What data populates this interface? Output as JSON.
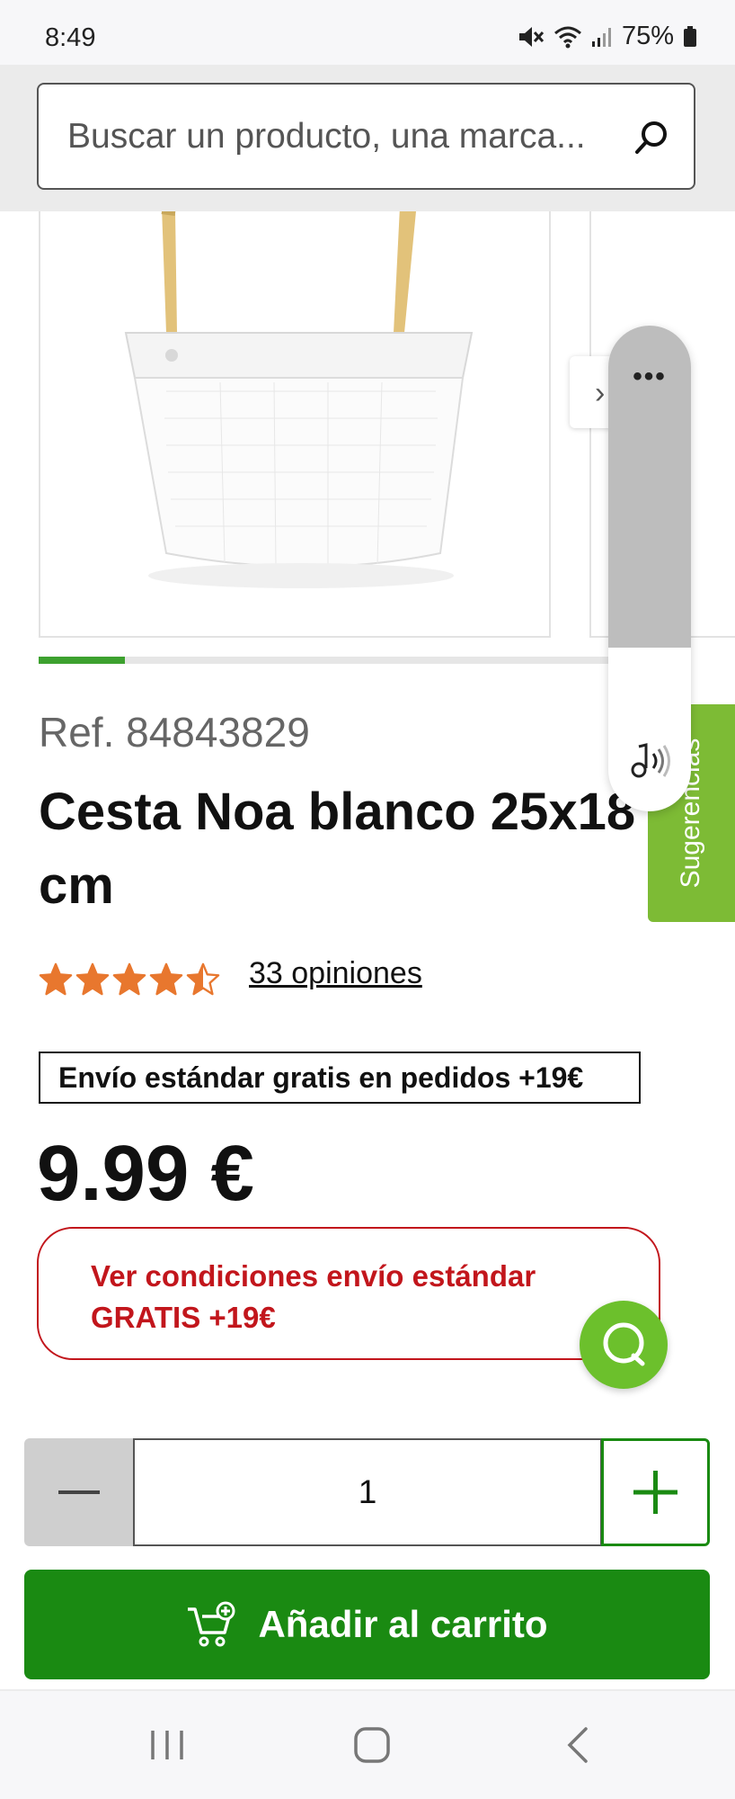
{
  "status_bar": {
    "time": "8:49",
    "battery": "75%"
  },
  "search": {
    "placeholder": "Buscar un producto, una marca..."
  },
  "gallery": {
    "progress": 0.15
  },
  "product": {
    "ref": "Ref. 84843829",
    "title": "Cesta Noa blanco 25x18 cm",
    "rating": 4.5,
    "reviews_label": "33 opiniones",
    "shipping_banner": "Envío estándar gratis en pedidos +19€",
    "price": "9.99 €",
    "conditions_label": "Ver condiciones envío estándar GRATIS +19€"
  },
  "quantity": {
    "value": "1"
  },
  "cart": {
    "add_label": "Añadir al carrito"
  },
  "suggestions_tab": {
    "label": "Sugerencias"
  },
  "floating_widget": {
    "menu": "•••"
  },
  "colors": {
    "brand_green": "#1a8a12",
    "accent_red": "#c2161c",
    "star_orange": "#e8772e",
    "suggest_green": "#7dbb35"
  },
  "icons": [
    "mute-icon",
    "wifi-icon",
    "signal-icon",
    "battery-icon",
    "search-icon",
    "chevron-right-icon",
    "star-icon",
    "chat-icon",
    "minus-icon",
    "plus-icon",
    "cart-add-icon",
    "recents-icon",
    "home-icon",
    "back-icon",
    "sound-icon"
  ]
}
